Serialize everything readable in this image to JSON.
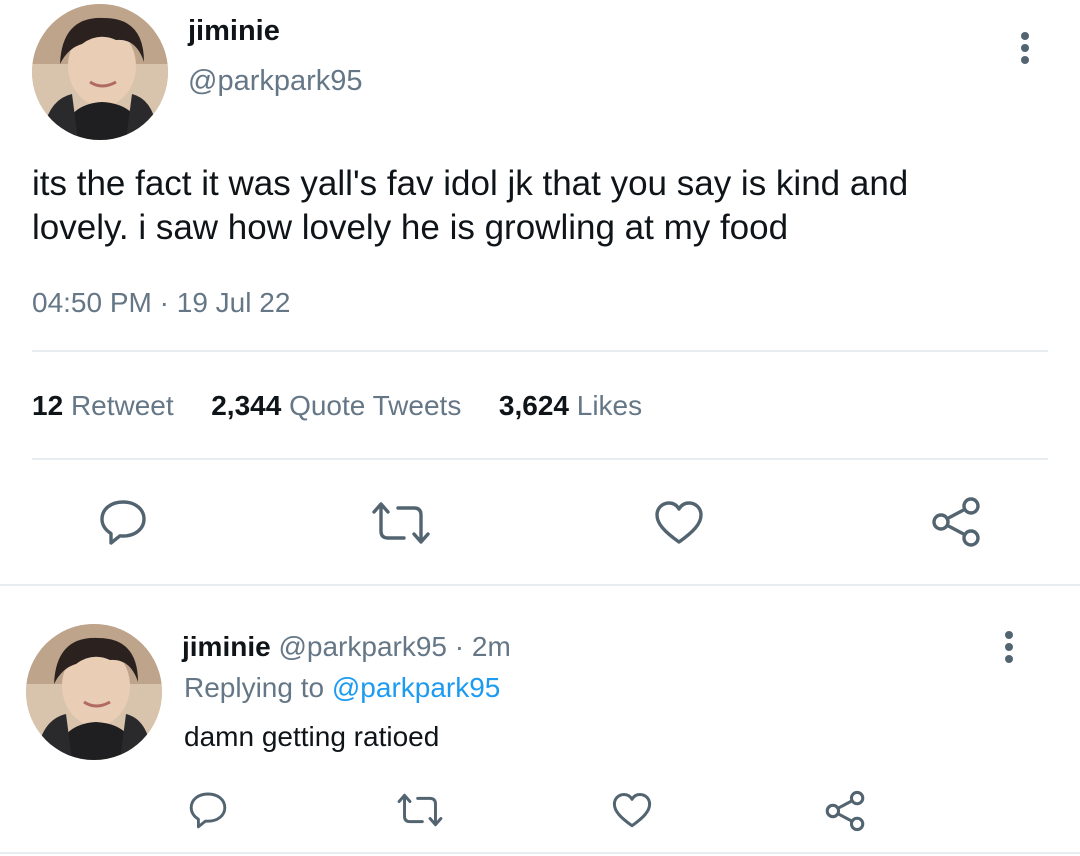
{
  "tweet": {
    "display_name": "jiminie",
    "handle": "@parkpark95",
    "text_line1": "its the fact it was yall's fav idol jk that you say is kind and",
    "text_line2": "lovely. i saw how lovely he is growling at my food",
    "time": "04:50 PM",
    "separator": "·",
    "date": "19 Jul 22",
    "stats": {
      "retweet_count": "12",
      "retweet_label": "Retweet",
      "quote_count": "2,344",
      "quote_label": "Quote Tweets",
      "like_count": "3,624",
      "like_label": "Likes"
    },
    "icons": [
      "reply-icon",
      "retweet-icon",
      "like-icon",
      "share-icon"
    ]
  },
  "reply": {
    "display_name": "jiminie",
    "handle": "@parkpark95",
    "dot": "·",
    "age": "2m",
    "replying_prefix": "Replying to",
    "replying_handle": "@parkpark95",
    "text": "damn getting ratioed",
    "icons": [
      "reply-icon",
      "retweet-icon",
      "like-icon",
      "share-icon"
    ]
  },
  "colors": {
    "text": "#0f1419",
    "muted": "#657786",
    "link": "#1d9bf0",
    "icon": "#536471",
    "divider": "#e6ecf0"
  }
}
